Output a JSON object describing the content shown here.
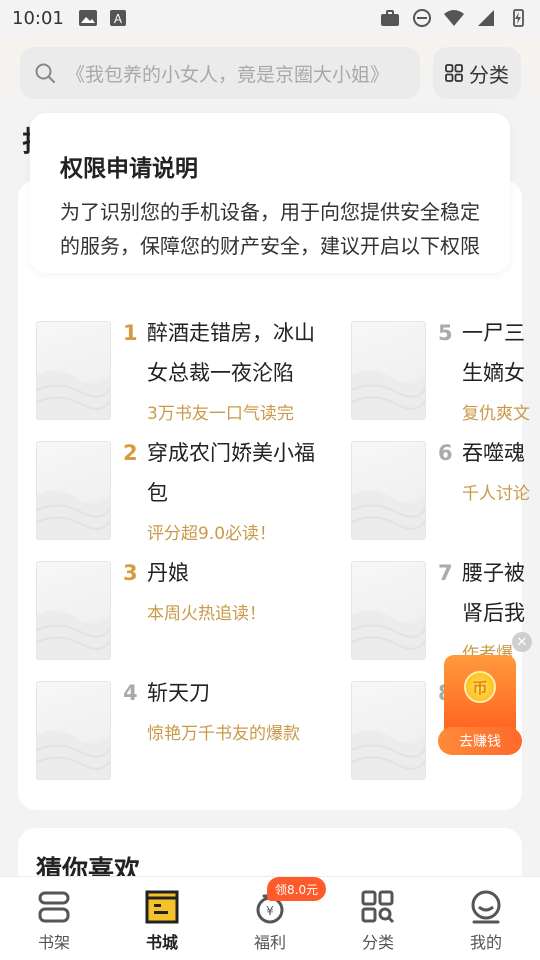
{
  "status_bar": {
    "time": "10:01"
  },
  "search": {
    "placeholder": "《我包养的小女人，竟是京圈大小姐》"
  },
  "category_button": {
    "label": "分类"
  },
  "section_heading_partial": "排",
  "permission_dialog": {
    "title": "权限申请说明",
    "body": "为了识别您的手机设备，用于向您提供安全稳定的服务，保障您的财产安全，建议开启以下权限"
  },
  "rank_list": [
    {
      "rank": "1",
      "title_lines": [
        "醉酒走错房，冰山",
        "女总裁一夜沦陷"
      ],
      "subtitle": "3万书友一口气读完",
      "rank_color": "#d89a3c"
    },
    {
      "rank": "2",
      "title_lines": [
        "穿成农门娇美小福",
        "包"
      ],
      "subtitle": "评分超9.0必读！",
      "rank_color": "#d89a3c"
    },
    {
      "rank": "3",
      "title_lines": [
        "丹娘"
      ],
      "subtitle": "本周火热追读！",
      "rank_color": "#d89a3c"
    },
    {
      "rank": "4",
      "title_lines": [
        "斩天刀"
      ],
      "subtitle": "惊艳万千书友的爆款",
      "rank_color": "#aaaaaa"
    },
    {
      "rank": "5",
      "title_lines": [
        "一尸三",
        "生嫡女"
      ],
      "subtitle": "复仇爽文",
      "rank_color": "#aaaaaa"
    },
    {
      "rank": "6",
      "title_lines": [
        "吞噬魂"
      ],
      "subtitle": "千人讨论",
      "rank_color": "#aaaaaa"
    },
    {
      "rank": "7",
      "title_lines": [
        "腰子被",
        "肾后我"
      ],
      "subtitle": "作者爆",
      "rank_color": "#aaaaaa"
    },
    {
      "rank": "8",
      "title_lines": [
        ""
      ],
      "subtitle": "",
      "rank_color": "#aaaaaa"
    }
  ],
  "earn_widget": {
    "coin_label": "币",
    "button_label": "去赚钱"
  },
  "guess_section": {
    "title": "猜你喜欢"
  },
  "bottom_nav": {
    "items": [
      {
        "label": "书架"
      },
      {
        "label": "书城"
      },
      {
        "label": "福利"
      },
      {
        "label": "分类"
      },
      {
        "label": "我的"
      }
    ],
    "welfare_badge": "领8.0元"
  }
}
